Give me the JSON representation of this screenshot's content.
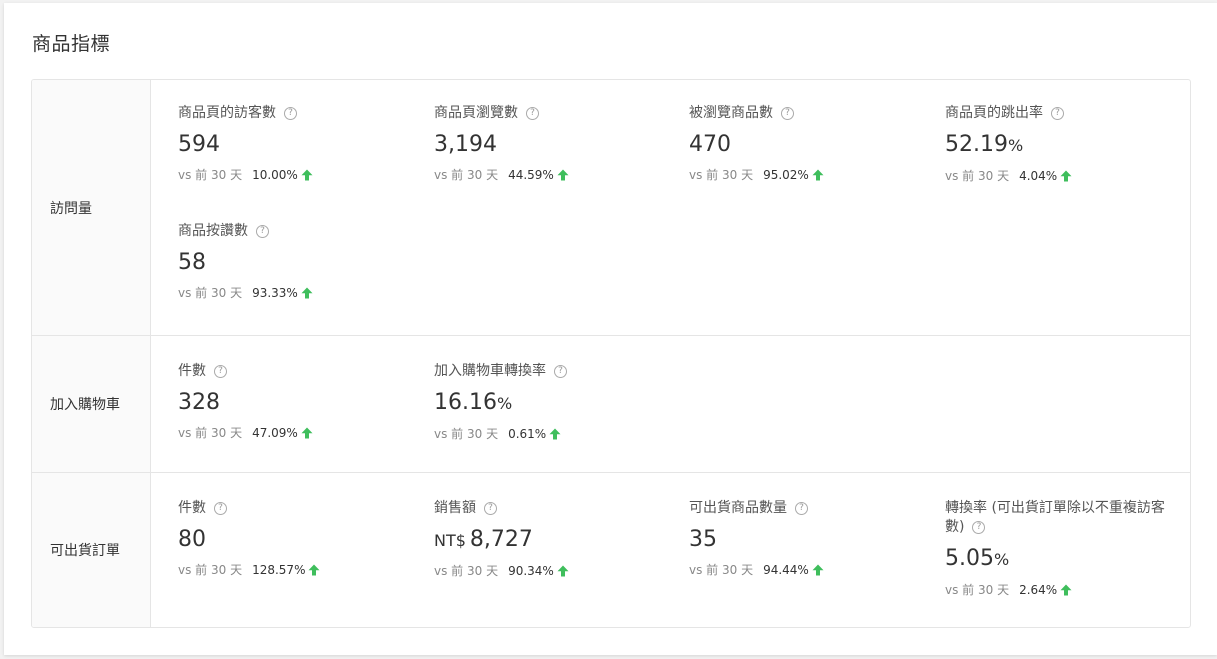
{
  "title": "商品指標",
  "compare_prefix": "vs 前 30 天",
  "up_color": "#3fbe5c",
  "help_glyph": "?",
  "sections": [
    {
      "label": "訪問量",
      "metrics": [
        {
          "title": "商品頁的訪客數",
          "value": "594",
          "unit": "",
          "prefix": "",
          "pct": "10.00%",
          "trend": "up"
        },
        {
          "title": "商品頁瀏覽數",
          "value": "3,194",
          "unit": "",
          "prefix": "",
          "pct": "44.59%",
          "trend": "up"
        },
        {
          "title": "被瀏覽商品數",
          "value": "470",
          "unit": "",
          "prefix": "",
          "pct": "95.02%",
          "trend": "up"
        },
        {
          "title": "商品頁的跳出率",
          "value": "52.19",
          "unit": "%",
          "prefix": "",
          "pct": "4.04%",
          "trend": "up"
        },
        {
          "title": "商品按讚數",
          "value": "58",
          "unit": "",
          "prefix": "",
          "pct": "93.33%",
          "trend": "up"
        }
      ]
    },
    {
      "label": "加入購物車",
      "metrics": [
        {
          "title": "件數",
          "value": "328",
          "unit": "",
          "prefix": "",
          "pct": "47.09%",
          "trend": "up"
        },
        {
          "title": "加入購物車轉換率",
          "value": "16.16",
          "unit": "%",
          "prefix": "",
          "pct": "0.61%",
          "trend": "up"
        }
      ]
    },
    {
      "label": "可出貨訂單",
      "metrics": [
        {
          "title": "件數",
          "value": "80",
          "unit": "",
          "prefix": "",
          "pct": "128.57%",
          "trend": "up"
        },
        {
          "title": "銷售額",
          "value": "8,727",
          "unit": "",
          "prefix": "NT$",
          "pct": "90.34%",
          "trend": "up"
        },
        {
          "title": "可出貨商品數量",
          "value": "35",
          "unit": "",
          "prefix": "",
          "pct": "94.44%",
          "trend": "up"
        },
        {
          "title": "轉換率 (可出貨訂單除以不重複訪客數)",
          "value": "5.05",
          "unit": "%",
          "prefix": "",
          "pct": "2.64%",
          "trend": "up"
        }
      ]
    }
  ]
}
